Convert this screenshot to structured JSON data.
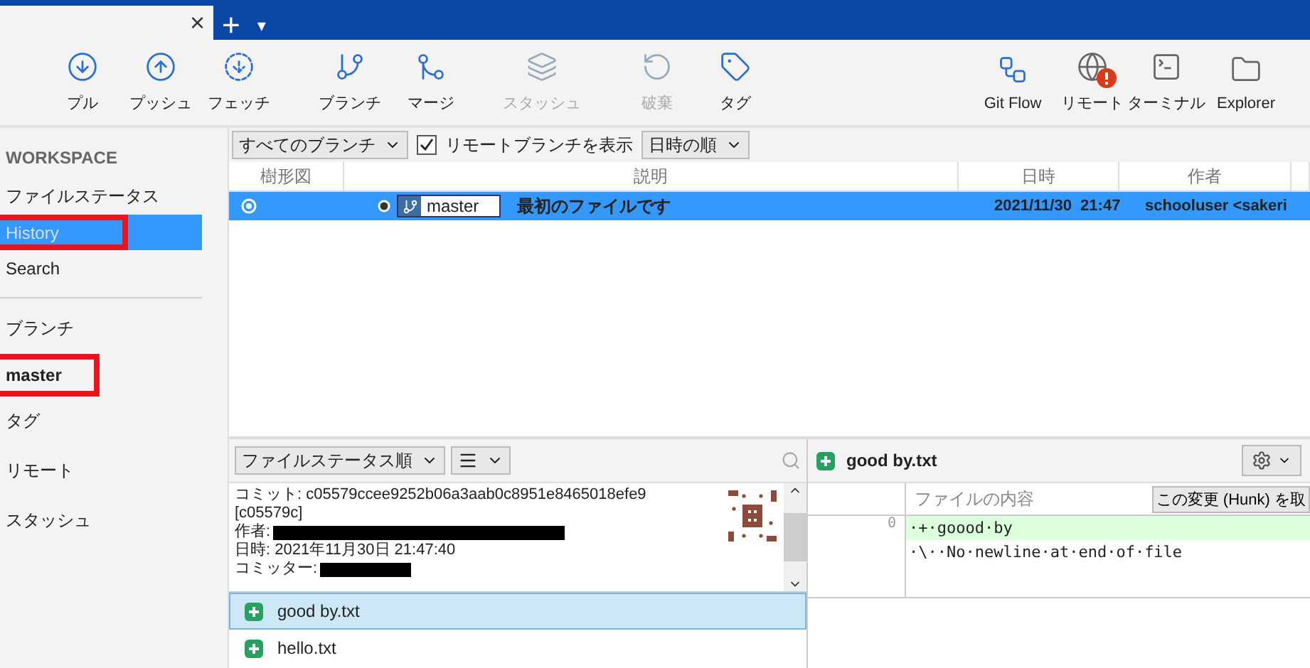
{
  "tabs": {
    "close": "×",
    "add": "+",
    "menu": "▾"
  },
  "toolbar": [
    {
      "label": "プル",
      "disabled": false,
      "alert": false
    },
    {
      "label": "プッシュ",
      "disabled": false,
      "alert": false
    },
    {
      "label": "フェッチ",
      "disabled": false,
      "alert": false
    },
    {
      "label": "ブランチ",
      "disabled": false,
      "alert": false
    },
    {
      "label": "マージ",
      "disabled": false,
      "alert": false
    },
    {
      "label": "スタッシュ",
      "disabled": true,
      "alert": false
    },
    {
      "label": "破棄",
      "disabled": true,
      "alert": false
    },
    {
      "label": "タグ",
      "disabled": false,
      "alert": false
    },
    {
      "label": "Git Flow",
      "disabled": false,
      "alert": false
    },
    {
      "label": "リモート",
      "disabled": false,
      "alert": true
    },
    {
      "label": "ターミナル",
      "disabled": false,
      "alert": false
    },
    {
      "label": "Explorer",
      "disabled": false,
      "alert": false
    }
  ],
  "sidebar": {
    "items": [
      {
        "kind": "heading",
        "label": "WORKSPACE"
      },
      {
        "kind": "item",
        "label": "ファイルステータス",
        "selected": false,
        "highlighted": false
      },
      {
        "kind": "item",
        "label": "History",
        "selected": true,
        "highlighted": true
      },
      {
        "kind": "item",
        "label": "Search",
        "selected": false,
        "highlighted": false
      },
      {
        "kind": "divider"
      },
      {
        "kind": "section",
        "label": "ブランチ",
        "selected": false,
        "highlighted": false
      },
      {
        "kind": "branch",
        "label": "master",
        "selected": false,
        "highlighted": true
      },
      {
        "kind": "section",
        "label": "タグ",
        "selected": false,
        "highlighted": false
      },
      {
        "kind": "section",
        "label": "リモート",
        "selected": false,
        "highlighted": false
      },
      {
        "kind": "section",
        "label": "スタッシュ",
        "selected": false,
        "highlighted": false
      }
    ]
  },
  "filter_bar": {
    "branches": "すべてのブランチ",
    "show_remote": {
      "label": "リモートブランチを表示",
      "checked": true
    },
    "order": "日時の順"
  },
  "table": {
    "columns": [
      "樹形図",
      "説明",
      "日時",
      "作者"
    ],
    "rows": [
      {
        "selected": true,
        "branch": "master",
        "description": "最初のファイルです",
        "date": "2021/11/30  21:47",
        "author": "schooluser <sakeri"
      }
    ]
  },
  "details": {
    "sort": "ファイルステータス順",
    "commit": [
      {
        "kind": "text",
        "label": "コミット:",
        "value": "c05579ccee9252b06a3aab0c8951e8465018efe9"
      },
      {
        "kind": "text",
        "value": "[c05579c]"
      },
      {
        "kind": "redacted",
        "label": "作者:"
      },
      {
        "kind": "text",
        "label": "日時:",
        "value": "2021年11月30日 21:47:40"
      },
      {
        "kind": "redacted",
        "label": "コミッター:"
      }
    ],
    "files": [
      {
        "name": "good by.txt",
        "selected": true
      },
      {
        "name": "hello.txt",
        "selected": false
      }
    ]
  },
  "diff": {
    "file": "good by.txt",
    "column": "ファイルの内容",
    "hunk_button": "この変更 (Hunk) を取",
    "lines": [
      {
        "number": "0",
        "text": "·+·goood·by",
        "kind": "added"
      },
      {
        "text": "·\\··No·newline·at·end·of·file",
        "kind": "context"
      }
    ]
  }
}
